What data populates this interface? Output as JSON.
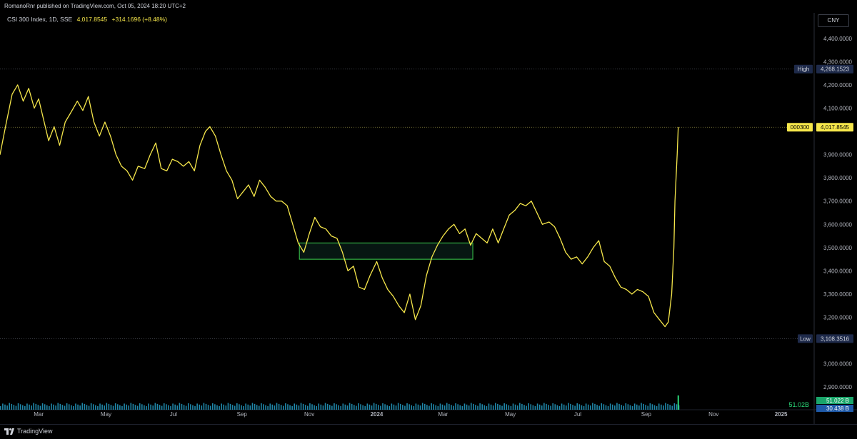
{
  "header": {
    "published": "RomanoRnr published on TradingView.com, Oct 05, 2024 18:20 UTC+2"
  },
  "legend": {
    "name": "CSI 300 Index, 1D, SSE",
    "price": "4,017.8545",
    "change": "+314.1696 (+8.48%)"
  },
  "currency_button": "CNY",
  "footer": {
    "brand": "TradingView"
  },
  "colors": {
    "line": "#f6e74b",
    "rect": "#3ccf4e",
    "background": "#000000",
    "volume": "#26a0c8",
    "volume_last": "#2bd97a"
  },
  "chart_data": {
    "type": "line",
    "series_name": "CSI 300 Index, 1D, SSE",
    "x_tick_labels": [
      "Mar",
      "May",
      "Jul",
      "Sep",
      "Nov",
      "2024",
      "Mar",
      "May",
      "Jul",
      "Sep",
      "Nov",
      "2025"
    ],
    "y_tick_labels": [
      "4,400.0000",
      "4,300.0000",
      "4,200.0000",
      "4,100.0000",
      "3,900.0000",
      "3,800.0000",
      "3,700.0000",
      "3,600.0000",
      "3,500.0000",
      "3,400.0000",
      "3,300.0000",
      "3,200.0000",
      "3,000.0000",
      "2,900.0000"
    ],
    "y_ticks": [
      4400,
      4300,
      4200,
      4100,
      3900,
      3800,
      3700,
      3600,
      3500,
      3400,
      3300,
      3200,
      3000,
      2900
    ],
    "ylim": [
      2870,
      4510
    ],
    "x_range": [
      "2023-01-25",
      "2025-01-31"
    ],
    "markers": [
      {
        "label": "High",
        "value_label": "4,268.1523",
        "value": 4268.1523
      },
      {
        "label": "000300",
        "value_label": "4,017.8545",
        "value": 4017.8545
      },
      {
        "label": "Low",
        "value_label": "3,108.3516",
        "value": 3108.3516
      }
    ],
    "annotation_rect": {
      "x_start": "2023-10-23",
      "x_end": "2024-03-28",
      "y_low": 3450,
      "y_high": 3520
    },
    "series": [
      {
        "name": "",
        "points": [
          [
            "2023-01-25",
            3900
          ],
          [
            "2023-01-30",
            4020
          ],
          [
            "2023-02-05",
            4160
          ],
          [
            "2023-02-10",
            4200
          ],
          [
            "2023-02-15",
            4130
          ],
          [
            "2023-02-20",
            4185
          ],
          [
            "2023-02-25",
            4100
          ],
          [
            "2023-03-01",
            4140
          ],
          [
            "2023-03-05",
            4060
          ],
          [
            "2023-03-10",
            3960
          ],
          [
            "2023-03-15",
            4020
          ],
          [
            "2023-03-20",
            3940
          ],
          [
            "2023-03-25",
            4040
          ],
          [
            "2023-03-30",
            4080
          ],
          [
            "2023-04-05",
            4130
          ],
          [
            "2023-04-10",
            4090
          ],
          [
            "2023-04-15",
            4150
          ],
          [
            "2023-04-20",
            4040
          ],
          [
            "2023-04-25",
            3980
          ],
          [
            "2023-04-30",
            4040
          ],
          [
            "2023-05-05",
            3980
          ],
          [
            "2023-05-10",
            3900
          ],
          [
            "2023-05-15",
            3850
          ],
          [
            "2023-05-20",
            3830
          ],
          [
            "2023-05-25",
            3790
          ],
          [
            "2023-05-30",
            3850
          ],
          [
            "2023-06-05",
            3840
          ],
          [
            "2023-06-10",
            3900
          ],
          [
            "2023-06-15",
            3950
          ],
          [
            "2023-06-20",
            3840
          ],
          [
            "2023-06-25",
            3830
          ],
          [
            "2023-06-30",
            3880
          ],
          [
            "2023-07-05",
            3870
          ],
          [
            "2023-07-10",
            3850
          ],
          [
            "2023-07-15",
            3870
          ],
          [
            "2023-07-20",
            3830
          ],
          [
            "2023-07-25",
            3940
          ],
          [
            "2023-07-30",
            4000
          ],
          [
            "2023-08-03",
            4020
          ],
          [
            "2023-08-08",
            3980
          ],
          [
            "2023-08-13",
            3900
          ],
          [
            "2023-08-18",
            3830
          ],
          [
            "2023-08-23",
            3790
          ],
          [
            "2023-08-28",
            3710
          ],
          [
            "2023-09-02",
            3740
          ],
          [
            "2023-09-07",
            3770
          ],
          [
            "2023-09-12",
            3720
          ],
          [
            "2023-09-17",
            3790
          ],
          [
            "2023-09-22",
            3760
          ],
          [
            "2023-09-27",
            3720
          ],
          [
            "2023-10-02",
            3700
          ],
          [
            "2023-10-07",
            3700
          ],
          [
            "2023-10-12",
            3680
          ],
          [
            "2023-10-17",
            3600
          ],
          [
            "2023-10-22",
            3520
          ],
          [
            "2023-10-27",
            3480
          ],
          [
            "2023-11-01",
            3560
          ],
          [
            "2023-11-06",
            3630
          ],
          [
            "2023-11-11",
            3590
          ],
          [
            "2023-11-16",
            3580
          ],
          [
            "2023-11-21",
            3550
          ],
          [
            "2023-11-26",
            3540
          ],
          [
            "2023-12-01",
            3480
          ],
          [
            "2023-12-06",
            3400
          ],
          [
            "2023-12-11",
            3420
          ],
          [
            "2023-12-16",
            3330
          ],
          [
            "2023-12-21",
            3320
          ],
          [
            "2023-12-26",
            3380
          ],
          [
            "2024-01-01",
            3440
          ],
          [
            "2024-01-06",
            3370
          ],
          [
            "2024-01-11",
            3320
          ],
          [
            "2024-01-16",
            3290
          ],
          [
            "2024-01-21",
            3250
          ],
          [
            "2024-01-26",
            3220
          ],
          [
            "2024-01-31",
            3300
          ],
          [
            "2024-02-05",
            3190
          ],
          [
            "2024-02-10",
            3250
          ],
          [
            "2024-02-15",
            3380
          ],
          [
            "2024-02-20",
            3460
          ],
          [
            "2024-02-25",
            3510
          ],
          [
            "2024-03-01",
            3550
          ],
          [
            "2024-03-06",
            3580
          ],
          [
            "2024-03-11",
            3600
          ],
          [
            "2024-03-16",
            3560
          ],
          [
            "2024-03-21",
            3580
          ],
          [
            "2024-03-26",
            3510
          ],
          [
            "2024-03-31",
            3560
          ],
          [
            "2024-04-05",
            3540
          ],
          [
            "2024-04-10",
            3520
          ],
          [
            "2024-04-15",
            3580
          ],
          [
            "2024-04-20",
            3520
          ],
          [
            "2024-04-25",
            3580
          ],
          [
            "2024-04-30",
            3640
          ],
          [
            "2024-05-05",
            3660
          ],
          [
            "2024-05-10",
            3690
          ],
          [
            "2024-05-15",
            3680
          ],
          [
            "2024-05-20",
            3700
          ],
          [
            "2024-05-25",
            3650
          ],
          [
            "2024-05-30",
            3600
          ],
          [
            "2024-06-05",
            3610
          ],
          [
            "2024-06-10",
            3590
          ],
          [
            "2024-06-15",
            3540
          ],
          [
            "2024-06-20",
            3480
          ],
          [
            "2024-06-25",
            3450
          ],
          [
            "2024-06-30",
            3460
          ],
          [
            "2024-07-05",
            3430
          ],
          [
            "2024-07-10",
            3460
          ],
          [
            "2024-07-15",
            3500
          ],
          [
            "2024-07-20",
            3530
          ],
          [
            "2024-07-25",
            3440
          ],
          [
            "2024-07-30",
            3420
          ],
          [
            "2024-08-04",
            3370
          ],
          [
            "2024-08-09",
            3330
          ],
          [
            "2024-08-14",
            3320
          ],
          [
            "2024-08-19",
            3300
          ],
          [
            "2024-08-24",
            3320
          ],
          [
            "2024-08-29",
            3310
          ],
          [
            "2024-09-03",
            3290
          ],
          [
            "2024-09-08",
            3220
          ],
          [
            "2024-09-13",
            3190
          ],
          [
            "2024-09-18",
            3160
          ],
          [
            "2024-09-21",
            3180
          ],
          [
            "2024-09-24",
            3300
          ],
          [
            "2024-09-26",
            3500
          ],
          [
            "2024-09-27",
            3700
          ],
          [
            "2024-09-29",
            3900
          ],
          [
            "2024-09-30",
            4017.8545
          ]
        ]
      }
    ],
    "volume": {
      "last_value_label": "51.02B",
      "badges": [
        "51.022 B",
        "30.438 B"
      ]
    }
  }
}
